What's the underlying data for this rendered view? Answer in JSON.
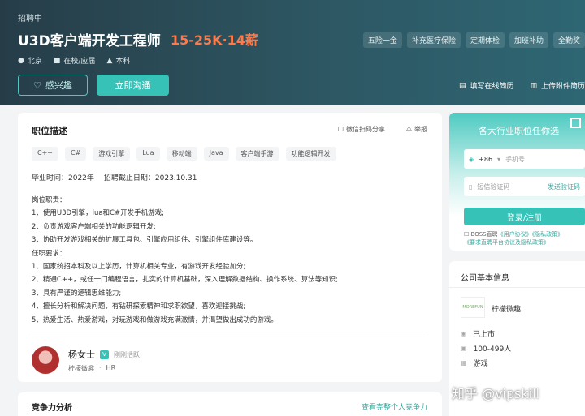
{
  "header": {
    "status": "招聘中",
    "job_title": "U3D客户端开发工程师",
    "salary": "15-25K·14薪",
    "benefits": [
      "五险一金",
      "补充医疗保险",
      "定期体检",
      "加班补助",
      "全勤奖"
    ],
    "location": "北京",
    "experience": "在校/应届",
    "education": "本科",
    "interest_label": "感兴趣",
    "chat_label": "立即沟通",
    "fill_resume": "填写在线简历",
    "upload_resume": "上传附件简历"
  },
  "job": {
    "section_title": "职位描述",
    "share_label": "微信扫码分享",
    "report_label": "举报",
    "skills": [
      "C++",
      "C#",
      "游戏引擎",
      "Lua",
      "移动端",
      "Java",
      "客户端手游",
      "功能逻辑开发"
    ],
    "graduation": "毕业时间：2022年",
    "deadline": "招聘截止日期：2023.10.31",
    "description": [
      "岗位职责：",
      "1、使用U3D引擎，lua和C#开发手机游戏;",
      "2、负责游戏客户端相关的功能逻辑开发;",
      "3、协助开发游戏相关的扩展工具包、引擎应用组件、引擎组件库建设等。",
      "任职要求：",
      "1、国家统招本科及以上学历，计算机相关专业，有游戏开发经验加分;",
      "2、精通C++，或任一门编程语言，扎实的计算机基础，深入理解数据结构、操作系统、算法等知识;",
      "3、具有严谨的逻辑思维能力;",
      "4、擅长分析和解决问题，有钻研探索精神和求职欲望，喜欢迎接挑战;",
      "5、热爱生活、热爱游戏，对玩游戏和做游戏充满激情，并渴望做出成功的游戏。"
    ]
  },
  "hr": {
    "name": "杨女士",
    "verified": "V",
    "active": "刚刚活跃",
    "company": "柠檬微趣",
    "separator": "·",
    "role": "HR"
  },
  "competition": {
    "title": "竞争力分析",
    "link": "查看完整个人竞争力"
  },
  "login": {
    "title": "各大行业职位任你选",
    "country_code": "+86",
    "phone_placeholder": "手机号",
    "code_placeholder": "短信验证码",
    "send_code": "发送验证码",
    "submit": "登录/注册",
    "agree_prefix": "BOSS直聘",
    "user_agreement": "《用户协议》",
    "privacy": "《隐私政策》",
    "agree_line2": "《要求直聘平台协议及隐私政策》"
  },
  "company": {
    "title": "公司基本信息",
    "logo_text": "MOREFUN",
    "name": "柠檬微趣",
    "stage": "已上市",
    "size": "100-499人",
    "industry": "游戏"
  },
  "watermark": "知乎 @vipskill"
}
